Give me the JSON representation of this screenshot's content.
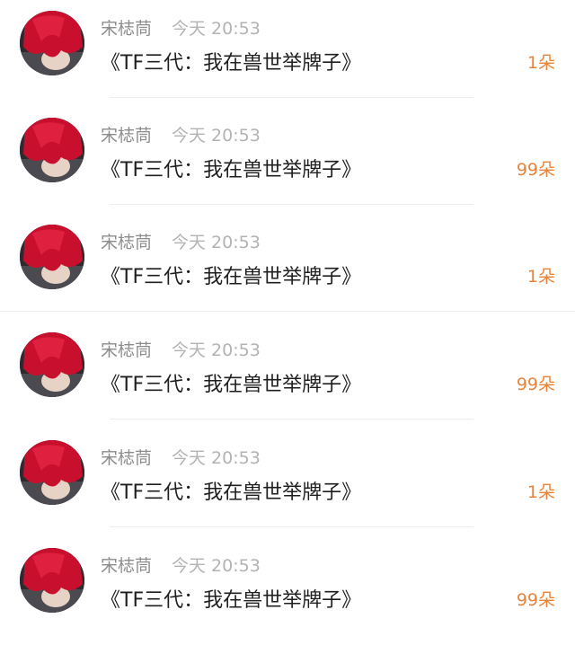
{
  "comments": [
    {
      "user": "宋梽茼",
      "time": "今天 20:53",
      "text": "《TF三代：我在兽世举牌子》",
      "gift": "1朵"
    },
    {
      "user": "宋梽茼",
      "time": "今天 20:53",
      "text": "《TF三代：我在兽世举牌子》",
      "gift": "99朵"
    },
    {
      "user": "宋梽茼",
      "time": "今天 20:53",
      "text": "《TF三代：我在兽世举牌子》",
      "gift": "1朵"
    },
    {
      "user": "宋梽茼",
      "time": "今天 20:53",
      "text": "《TF三代：我在兽世举牌子》",
      "gift": "99朵"
    },
    {
      "user": "宋梽茼",
      "time": "今天 20:53",
      "text": "《TF三代：我在兽世举牌子》",
      "gift": "1朵"
    },
    {
      "user": "宋梽茼",
      "time": "今天 20:53",
      "text": "《TF三代：我在兽世举牌子》",
      "gift": "99朵"
    }
  ],
  "colors": {
    "gift": "#e8843a",
    "name": "#8c8c8c",
    "time": "#b3b3b3",
    "text": "#1f1f1f",
    "avatar_hair": "#c8102e"
  }
}
